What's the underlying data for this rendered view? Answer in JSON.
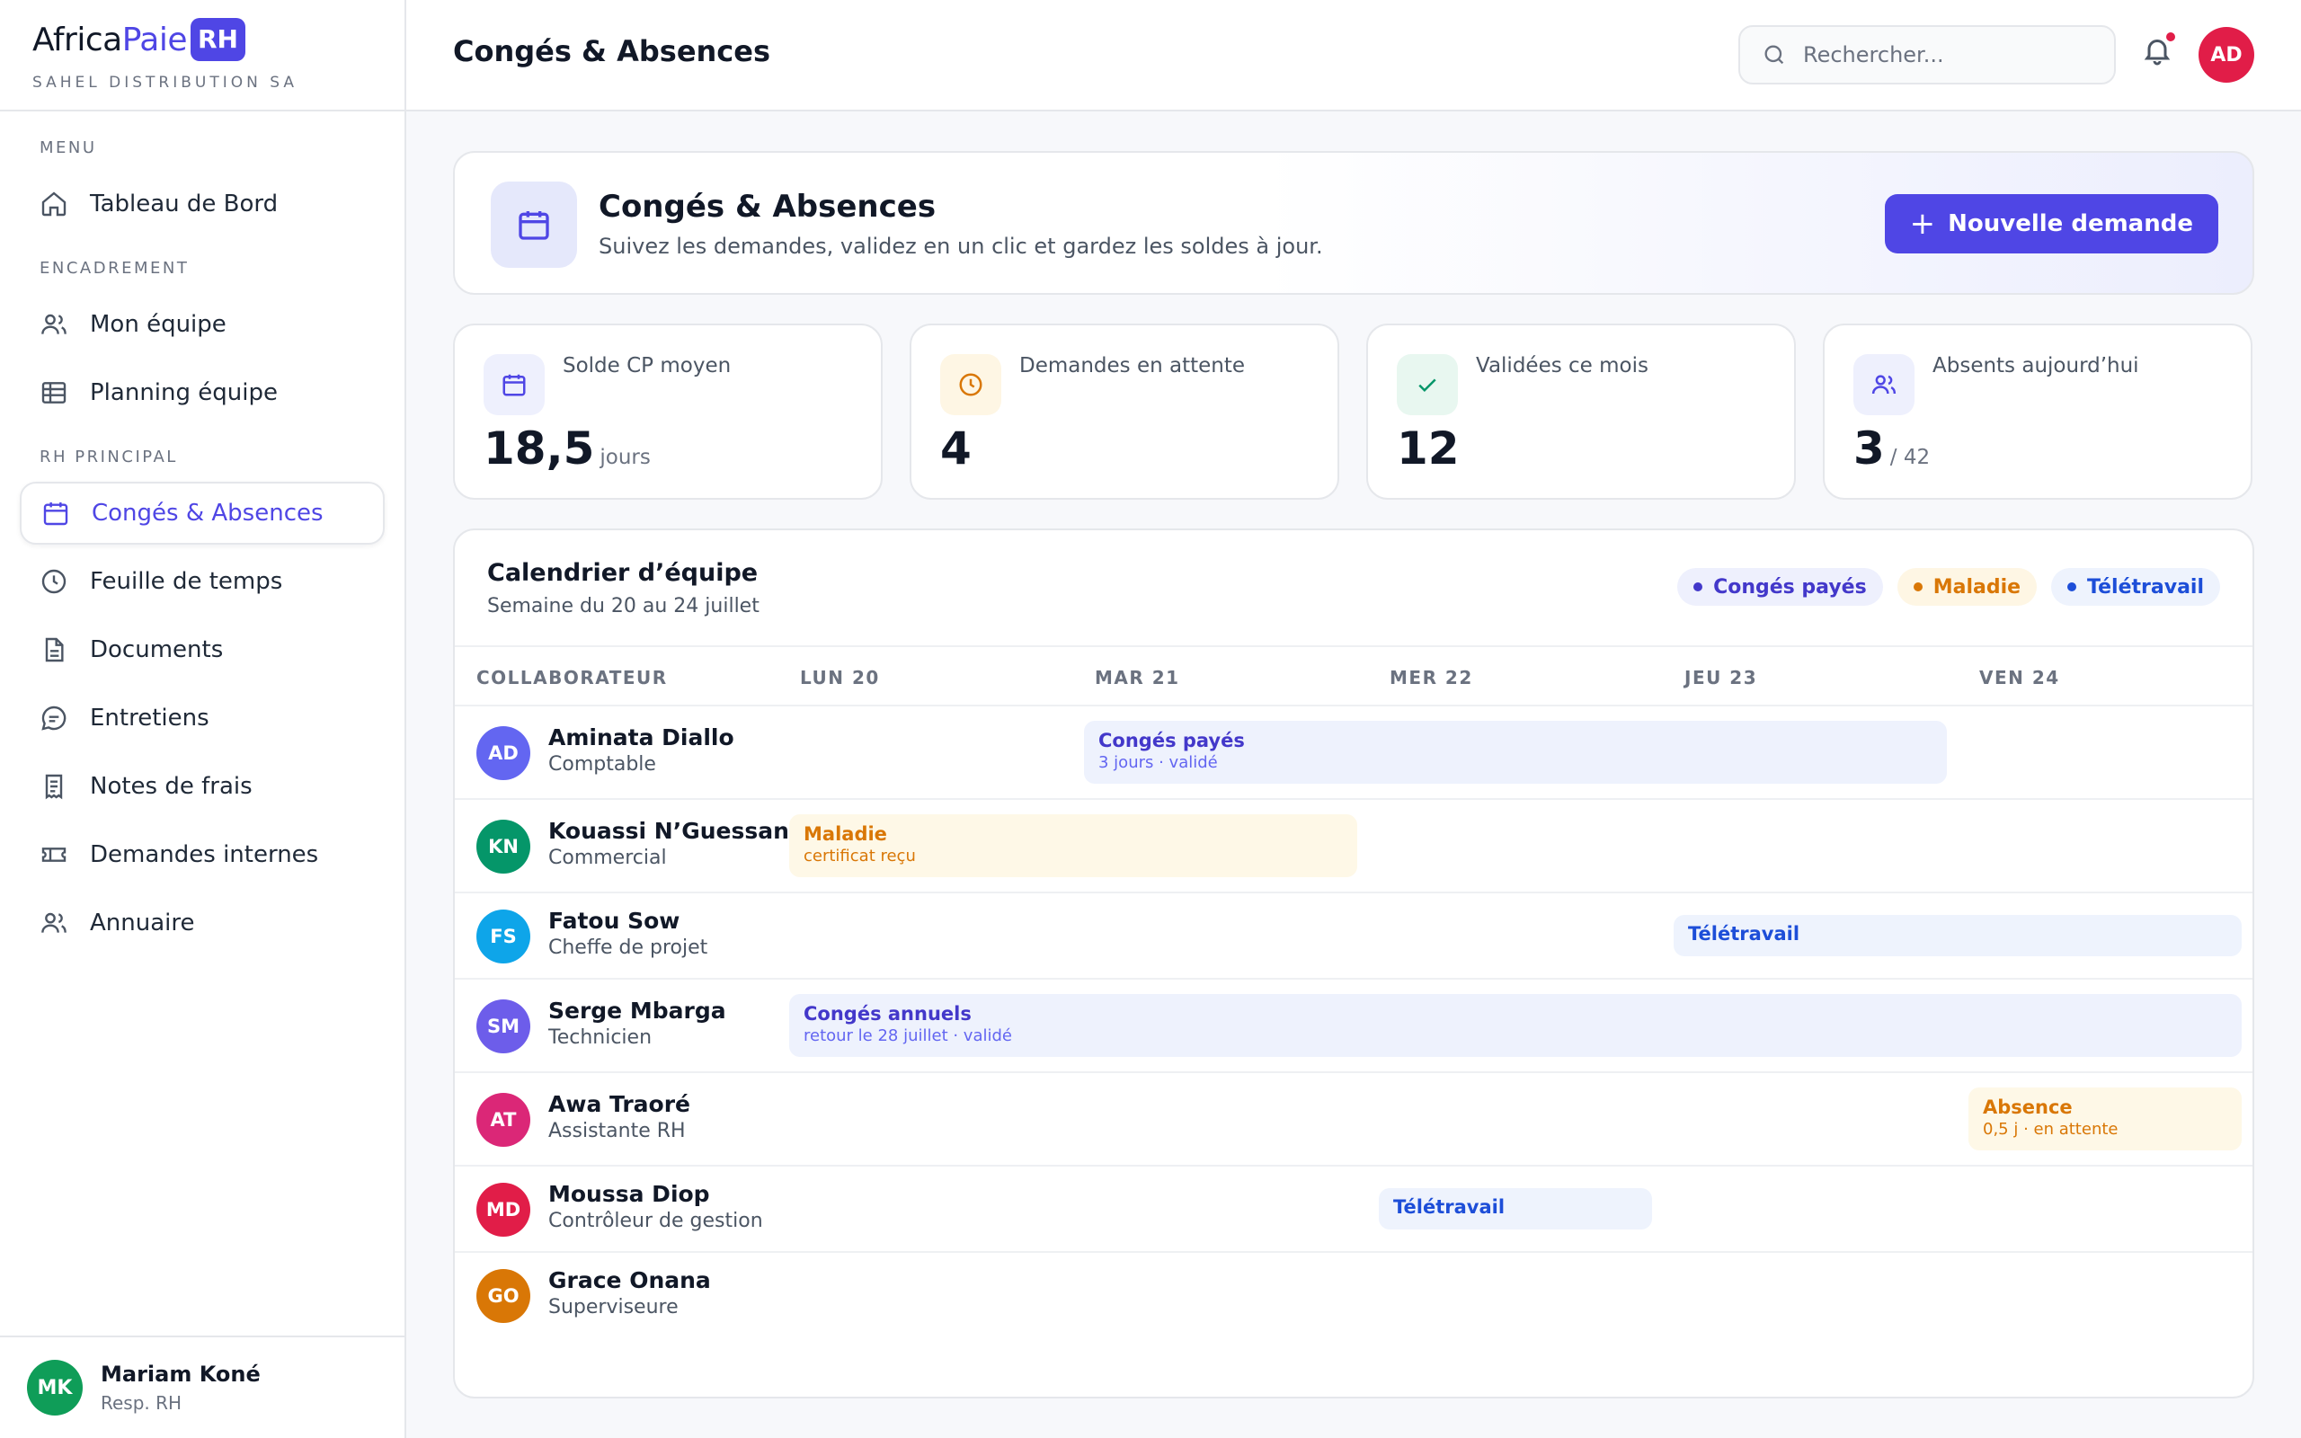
{
  "brand": {
    "name_part1": "Africa",
    "name_part2": "Paie",
    "badge": "RH",
    "company": "SAHEL DISTRIBUTION SA"
  },
  "sidebar": {
    "sections": [
      "MENU",
      "ENCADREMENT",
      "RH PRINCIPAL"
    ],
    "items": [
      {
        "label": "Tableau de Bord",
        "icon": "home-icon"
      },
      {
        "label": "Mon équipe",
        "icon": "users-icon"
      },
      {
        "label": "Planning équipe",
        "icon": "table-icon"
      },
      {
        "label": "Congés & Absences",
        "icon": "calendar-icon",
        "active": true
      },
      {
        "label": "Feuille de temps",
        "icon": "clock-icon"
      },
      {
        "label": "Documents",
        "icon": "document-icon"
      },
      {
        "label": "Entretiens",
        "icon": "chat-icon"
      },
      {
        "label": "Notes de frais",
        "icon": "receipt-icon"
      },
      {
        "label": "Demandes internes",
        "icon": "ticket-icon"
      },
      {
        "label": "Annuaire",
        "icon": "users-icon"
      }
    ],
    "user": {
      "initials": "MK",
      "name": "Mariam Koné",
      "role": "Resp. RH"
    }
  },
  "header": {
    "title": "Congés & Absences",
    "search_placeholder": "Rechercher...",
    "avatar_initials": "AD"
  },
  "hero": {
    "title": "Congés & Absences",
    "subtitle": "Suivez les demandes, validez en un clic et gardez les soldes à jour.",
    "button_label": "Nouvelle demande"
  },
  "stats": [
    {
      "label": "Solde CP moyen",
      "value": "18,5",
      "unit": "jours",
      "icon": "calendar-icon",
      "color": "#4f46e5",
      "bg": "#eef0fd"
    },
    {
      "label": "Demandes en attente",
      "value": "4",
      "unit": "",
      "icon": "clock-icon",
      "color": "#d97706",
      "bg": "#fef6e4"
    },
    {
      "label": "Validées ce mois",
      "value": "12",
      "unit": "",
      "icon": "check-icon",
      "color": "#059669",
      "bg": "#e8f7f0"
    },
    {
      "label": "Absents aujourd’hui",
      "value": "3",
      "unit": "/ 42",
      "icon": "users-icon",
      "color": "#4f46e5",
      "bg": "#eef0fd"
    }
  ],
  "calendar": {
    "title": "Calendrier d’équipe",
    "subtitle": "Semaine du 20 au 24 juillet",
    "legend": [
      {
        "label": "Congés payés",
        "color": "#4338ca",
        "bg": "#eef0fd"
      },
      {
        "label": "Maladie",
        "color": "#d97706",
        "bg": "#fef6e4"
      },
      {
        "label": "Télétravail",
        "color": "#1d4ed8",
        "bg": "#eef3fd"
      }
    ],
    "columns": [
      "COLLABORATEUR",
      "LUN 20",
      "MAR 21",
      "MER 22",
      "JEU 23",
      "VEN 24"
    ],
    "rows": [
      {
        "initials": "AD",
        "name": "Aminata Diallo",
        "role": "Comptable",
        "color": "#6366f1",
        "event": {
          "title": "Congés payés",
          "note": "3 jours · validé"
        }
      },
      {
        "initials": "KN",
        "name": "Kouassi N’Guessan",
        "role": "Commercial",
        "color": "#059669",
        "event": {
          "title": "Maladie",
          "note": "certificat reçu"
        }
      },
      {
        "initials": "FS",
        "name": "Fatou Sow",
        "role": "Cheffe de projet",
        "color": "#0ea5e9",
        "event": {
          "title": "Télétravail",
          "note": ""
        }
      },
      {
        "initials": "SM",
        "name": "Serge Mbarga",
        "role": "Technicien",
        "color": "#6d5dea",
        "event": {
          "title": "Congés annuels",
          "note": "retour le 28 juillet · validé"
        }
      },
      {
        "initials": "AT",
        "name": "Awa Traoré",
        "role": "Assistante RH",
        "color": "#db2777",
        "event": {
          "title": "Absence",
          "note": "0,5 j · en attente"
        }
      },
      {
        "initials": "MD",
        "name": "Moussa Diop",
        "role": "Contrôleur de gestion",
        "color": "#e11d48",
        "event": {
          "title": "Télétravail",
          "note": ""
        }
      },
      {
        "initials": "GO",
        "name": "Grace Onana",
        "role": "Superviseure",
        "color": "#d97706"
      }
    ]
  }
}
